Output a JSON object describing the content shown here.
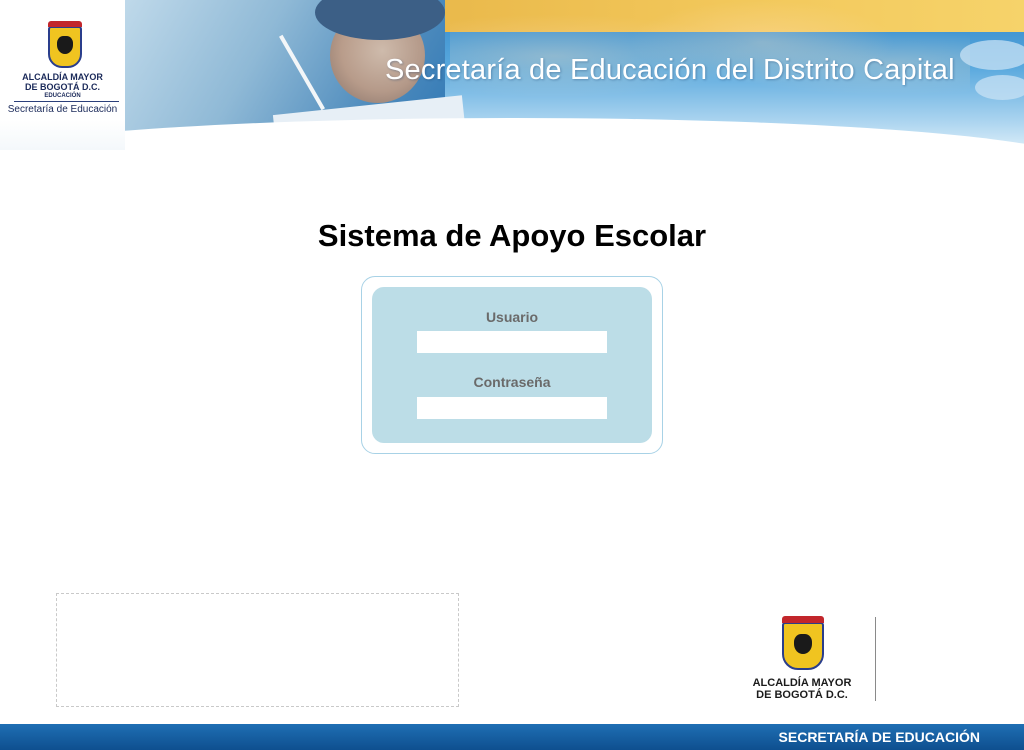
{
  "header": {
    "logo": {
      "line1": "ALCALDÍA MAYOR",
      "line2": "DE BOGOTÁ D.C.",
      "line3": "EDUCACIÓN",
      "line4": "Secretaría de Educación"
    },
    "title": "Secretaría de Educación del Distrito Capital"
  },
  "main": {
    "title": "Sistema de Apoyo Escolar",
    "login": {
      "user_label": "Usuario",
      "user_value": "",
      "password_label": "Contraseña",
      "password_value": ""
    }
  },
  "footer": {
    "logo_line1": "ALCALDÍA MAYOR",
    "logo_line2": "DE BOGOTÁ D.C.",
    "bar_text": "SECRETARÍA DE EDUCACIÓN"
  },
  "colors": {
    "banner_blue": "#2f86c9",
    "banner_gold": "#f2c75a",
    "login_panel": "#bcdde7",
    "footer_bar": "#0e4f8f"
  },
  "icons": [
    "bogota-coat-of-arms-icon"
  ]
}
